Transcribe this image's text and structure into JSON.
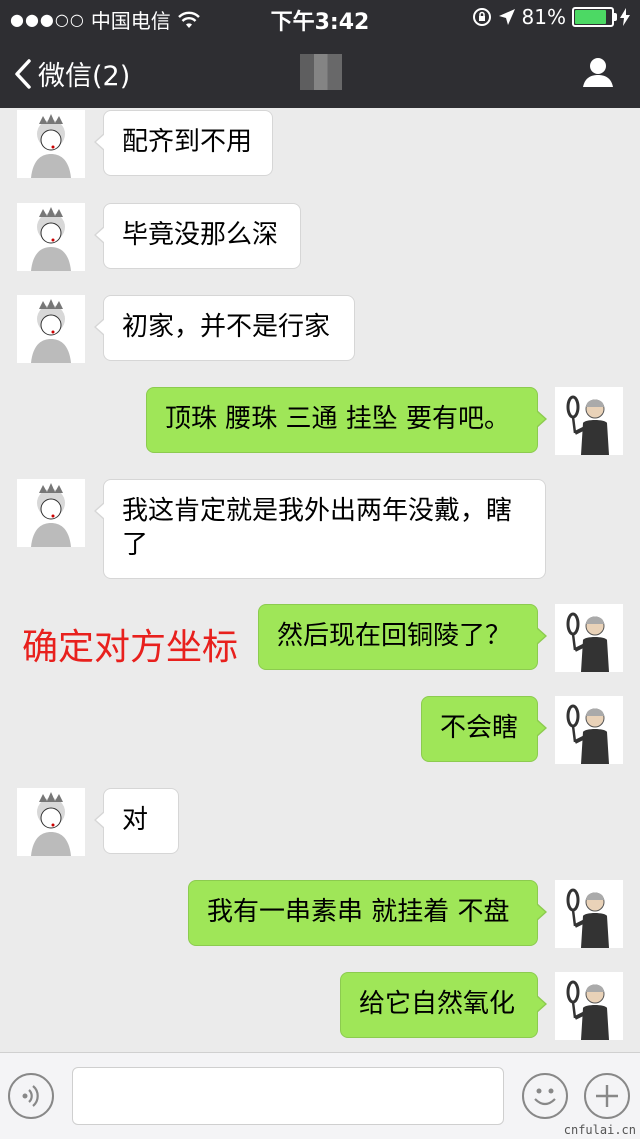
{
  "status_bar": {
    "signal_dots": "●●●○○",
    "carrier": "中国电信",
    "time": "下午3:42",
    "battery_percent": "81%",
    "battery_level": 0.81
  },
  "nav": {
    "back_label": "微信(2)"
  },
  "annotation": "确定对方坐标",
  "messages": [
    {
      "side": "in",
      "text": "配齐到不用"
    },
    {
      "side": "in",
      "text": "毕竟没那么深"
    },
    {
      "side": "in",
      "text": "初家，并不是行家"
    },
    {
      "side": "out",
      "text": "顶珠 腰珠 三通 挂坠 要有吧。"
    },
    {
      "side": "in",
      "text": "我这肯定就是我外出两年没戴，瞎了"
    },
    {
      "side": "out",
      "text": "然后现在回铜陵了？"
    },
    {
      "side": "out",
      "text": "不会瞎"
    },
    {
      "side": "in",
      "text": "对"
    },
    {
      "side": "out",
      "text": "我有一串素串 就挂着 不盘"
    },
    {
      "side": "out",
      "text": "给它自然氧化"
    }
  ],
  "watermark": "cnfulai.cn",
  "colors": {
    "header": "#2e2e32",
    "outgoing_bubble": "#9fe658",
    "incoming_bubble": "#ffffff",
    "annotation": "#e8201d",
    "background": "#ebebeb"
  }
}
